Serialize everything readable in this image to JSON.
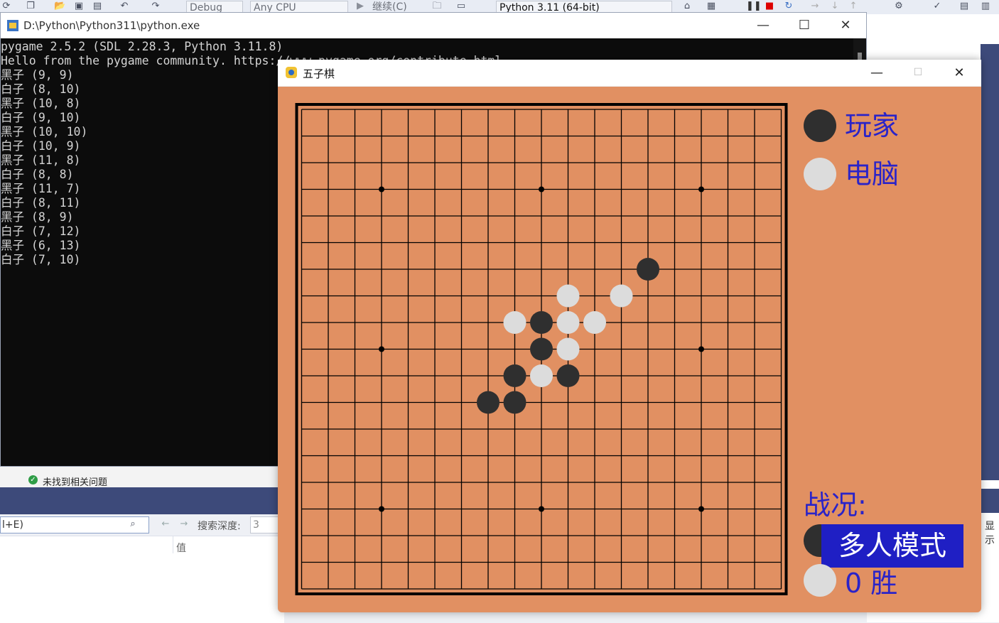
{
  "vs_toolbar": {
    "config": "Debug",
    "platform": "Any CPU",
    "continue_label": "继续(C)",
    "python_env": "Python 3.11 (64-bit)"
  },
  "console": {
    "title": "D:\\Python\\Python311\\python.exe",
    "lines": [
      "pygame 2.5.2 (SDL 2.28.3, Python 3.11.8)",
      "Hello from the pygame community. https://www.pygame.org/contribute.html",
      "黑子 (9, 9)",
      "白子 (8, 10)",
      "黑子 (10, 8)",
      "白子 (9, 10)",
      "黑子 (10, 10)",
      "白子 (10, 9)",
      "黑子 (11, 8)",
      "白子 (8, 8)",
      "黑子 (11, 7)",
      "白子 (8, 11)",
      "黑子 (8, 9)",
      "白子 (7, 12)",
      "黑子 (6, 13)",
      "白子 (7, 10)"
    ]
  },
  "vs_panels": {
    "status_text": "未找到相关问题",
    "search_value": "l+E)",
    "search_depth_label": "搜索深度:",
    "search_depth_value": "3",
    "column_value": "值",
    "right_label": "显示"
  },
  "game": {
    "title": "五子棋",
    "player_label": "玩家",
    "computer_label": "电脑",
    "status_label": "战况:",
    "mode_button": "多人模式",
    "score_text": "0 胜",
    "board_size": 19,
    "star_points": [
      [
        3,
        3
      ],
      [
        3,
        9
      ],
      [
        3,
        15
      ],
      [
        9,
        3
      ],
      [
        9,
        15
      ],
      [
        15,
        3
      ],
      [
        15,
        9
      ],
      [
        15,
        15
      ]
    ],
    "black_stones": [
      [
        9,
        9
      ],
      [
        10,
        8
      ],
      [
        10,
        10
      ],
      [
        11,
        8
      ],
      [
        11,
        7
      ],
      [
        8,
        9
      ],
      [
        6,
        13
      ]
    ],
    "white_stones": [
      [
        8,
        10
      ],
      [
        9,
        10
      ],
      [
        10,
        9
      ],
      [
        8,
        8
      ],
      [
        8,
        11
      ],
      [
        7,
        12
      ],
      [
        7,
        10
      ]
    ],
    "colors": {
      "board": "#e19062",
      "black": "#2f2f2f",
      "white": "#dcdcdc",
      "text": "#2a23c8",
      "button": "#1f1fc4"
    }
  }
}
